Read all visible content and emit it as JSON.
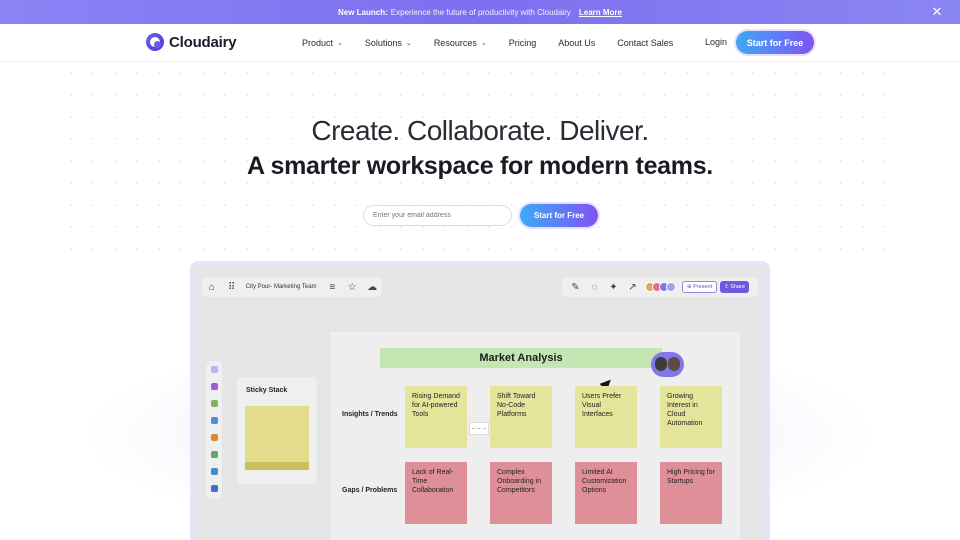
{
  "banner": {
    "badge": "New Launch:",
    "text": "Experience the future of productivity with Cloudairy",
    "link": "Learn More",
    "close": "✕"
  },
  "nav": {
    "brand": "Cloudairy",
    "menu": [
      {
        "label": "Product",
        "has_dropdown": true
      },
      {
        "label": "Solutions",
        "has_dropdown": true
      },
      {
        "label": "Resources",
        "has_dropdown": true
      },
      {
        "label": "Pricing",
        "has_dropdown": false
      },
      {
        "label": "About Us",
        "has_dropdown": false
      },
      {
        "label": "Contact Sales",
        "has_dropdown": false
      }
    ],
    "login": "Login",
    "cta": "Start for Free"
  },
  "hero": {
    "title": "Create. Collaborate. Deliver.",
    "subtitle": "A smarter workspace for modern teams.",
    "email_placeholder": "Enter your email address",
    "cta": "Start for Free"
  },
  "app": {
    "board_name": "City Pour- Marketing Team",
    "present": "Present",
    "share": "Share",
    "sticky_stack_title": "Sticky Stack",
    "board_title": "Market Analysis",
    "rows": [
      {
        "label": "Insights / Trends",
        "notes": [
          "Rising Demand for AI-powered Tools",
          "Shift Toward No-Code Platforms",
          "Users Prefer Visual Interfaces",
          "Growing Interest in Cloud Automation"
        ]
      },
      {
        "label": "Gaps / Problems",
        "notes": [
          "Lack of Real-Time Collaboration",
          "Complex Onboarding in Competitors",
          "Limited AI Customization Options",
          "High Pricing for Startups"
        ]
      }
    ],
    "colors": {
      "insight_note": "#e4e49a",
      "gap_note": "#df8f98",
      "title_bar": "#c4e6b2",
      "accent": "#6a5ae0"
    }
  }
}
